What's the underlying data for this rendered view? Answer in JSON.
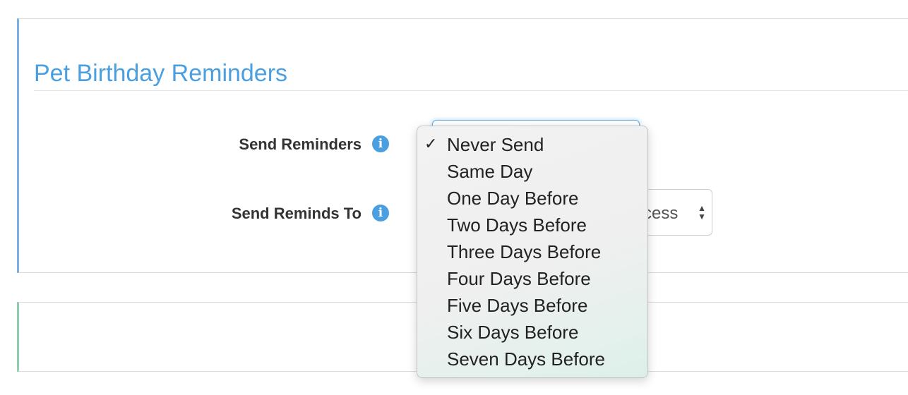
{
  "section": {
    "title": "Pet Birthday Reminders"
  },
  "fields": {
    "send_reminders": {
      "label": "Send Reminders",
      "info_icon": "info-icon",
      "selected": "Never Send"
    },
    "send_reminds_to": {
      "label": "Send Reminds To",
      "info_icon": "info-icon",
      "visible_value": "cess"
    }
  },
  "dropdown": {
    "check_mark": "✓",
    "options": [
      "Never Send",
      "Same Day",
      "One Day Before",
      "Two Days Before",
      "Three Days Before",
      "Four Days Before",
      "Five Days Before",
      "Six Days Before",
      "Seven Days Before"
    ],
    "selected_index": 0
  },
  "colors": {
    "accent_blue": "#4a9fe0",
    "panel_border_blue": "#77b1e6",
    "panel_border_green": "#8fd0ac"
  }
}
